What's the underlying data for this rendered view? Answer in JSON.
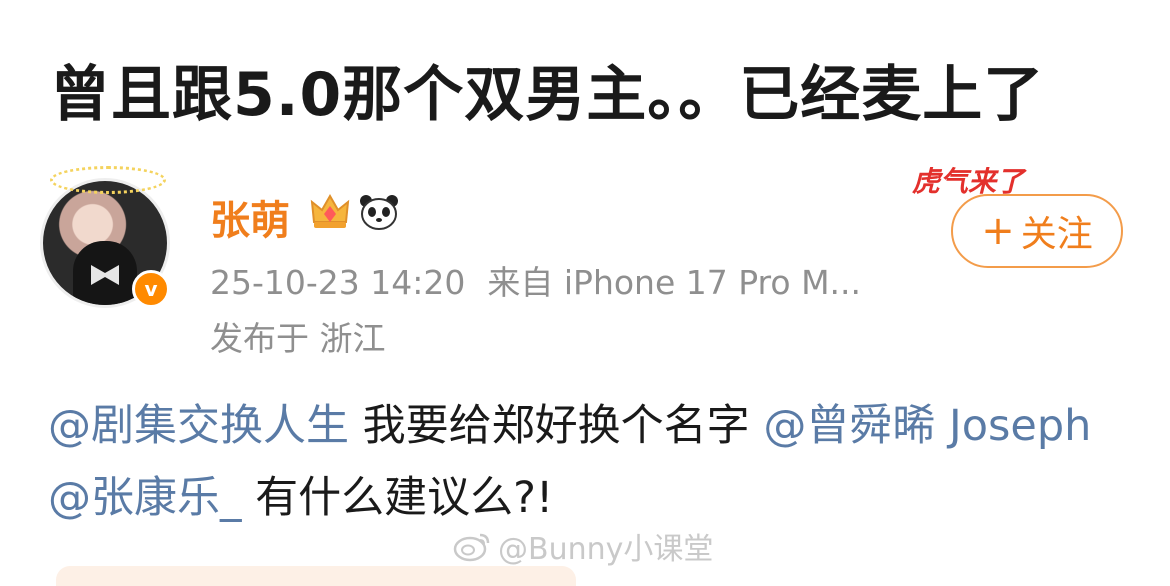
{
  "post": {
    "headline": "曾且跟5.0那个双男主。。已经麦上了",
    "username": "张萌",
    "timestamp": "25-10-23 14:20",
    "source": "来自 iPhone 17 Pro M...",
    "location": "发布于 浙江",
    "follow_label": "关注",
    "follow_plus": "+",
    "verified_badge": "v",
    "body": {
      "mention_1": "@剧集交换人生",
      "text_1": " 我要给郑好换个名字 ",
      "mention_2": "@曾舜晞 Joseph",
      "text_2": " ",
      "mention_3": "@张康乐_",
      "text_3": " 有什么建议么?!"
    },
    "sticker_text": "虎气来了",
    "watermark": "@Bunny小课堂"
  },
  "icons": {
    "crown": "crown-icon",
    "panda": "panda-icon",
    "weibo": "weibo-icon"
  },
  "colors": {
    "username": "#f07e1c",
    "mention": "#5a7ba6",
    "meta": "#8f8f8f",
    "follow_border": "#f39c4a"
  }
}
